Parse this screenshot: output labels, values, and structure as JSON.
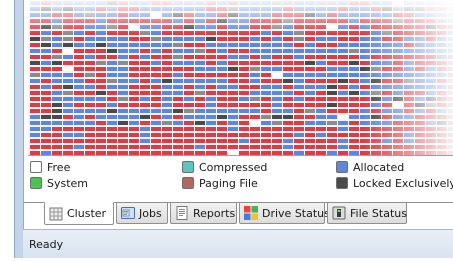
{
  "colors": {
    "free": "#ffffff",
    "system": "#4dc44d",
    "compressed": "#5fc3c3",
    "paging_file": "#b46a5a",
    "allocated": "#5f86dd",
    "locked": "#4a4a4a",
    "fragmented": "#dc3c46",
    "unmovable": "#8c8c8c"
  },
  "legend": [
    {
      "label": "Free",
      "color": "#ffffff"
    },
    {
      "label": "System",
      "color": "#4dc44d"
    },
    {
      "label": "Compressed",
      "color": "#5fc3c3"
    },
    {
      "label": "Paging File",
      "color": "#b46a5a"
    },
    {
      "label": "Allocated",
      "color": "#5f86dd"
    },
    {
      "label": "Locked Exclusively",
      "color": "#4a4a4a"
    }
  ],
  "tabs": [
    {
      "label": "Cluster",
      "icon": "cluster-icon",
      "active": true
    },
    {
      "label": "Jobs",
      "icon": "jobs-icon",
      "active": false
    },
    {
      "label": "Reports",
      "icon": "reports-icon",
      "active": false
    },
    {
      "label": "Drive Status",
      "icon": "drive-status-icon",
      "active": false
    },
    {
      "label": "File Status",
      "icon": "file-status-icon",
      "active": false
    }
  ],
  "status": {
    "text": "Ready"
  }
}
